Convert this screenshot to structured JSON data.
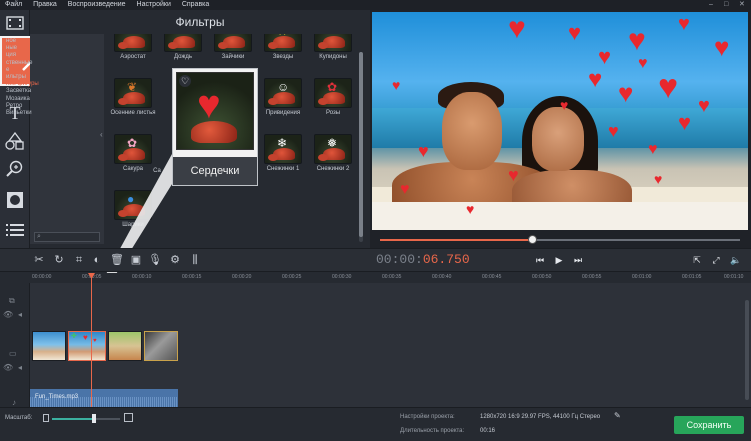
{
  "menu": {
    "items": [
      "Файл",
      "Правка",
      "Воспроизведение",
      "Настройки",
      "Справка"
    ]
  },
  "filters_panel": {
    "title": "Фильтры",
    "categories": [
      "ное",
      "ные",
      "ция",
      "ственные",
      "е",
      "ильтры",
      "ние фигуры",
      "Засветка",
      "Мозаика",
      "Ретро",
      "Виньетки"
    ],
    "active_category": "ние фигуры",
    "tiles": [
      {
        "label": "Аэростат"
      },
      {
        "label": "Дождь"
      },
      {
        "label": "Зайчики"
      },
      {
        "label": "Звезды"
      },
      {
        "label": "Купидоны"
      },
      {
        "label": "Осенние листья"
      },
      {
        "label": "Привидения"
      },
      {
        "label": "Розы"
      },
      {
        "label": "Сакура"
      },
      {
        "label": "Са"
      },
      {
        "label": "Снежинки 1"
      },
      {
        "label": "Снежинки 2"
      },
      {
        "label": "Шарики"
      }
    ],
    "hover_preview": {
      "label": "Сердечки"
    }
  },
  "player": {
    "timecode_dim": "00:00:",
    "timecode_live": "06.750",
    "progress": 0.42
  },
  "timeline": {
    "ruler": [
      "00:00:00",
      "00:00:05",
      "00:00:10",
      "00:00:15",
      "00:00:20",
      "00:00:25",
      "00:00:30",
      "00:00:35",
      "00:00:40",
      "00:00:45",
      "00:00:50",
      "00:00:55",
      "00:01:00",
      "00:01:05",
      "00:01:10",
      "00:01:15"
    ],
    "audio_clip": "Fun_Times.mp3"
  },
  "bottom": {
    "scale_label": "Масштаб:",
    "scale_level": 0.62,
    "project_settings_label": "Настройки проекта:",
    "project_settings_value": "1280x720 16:9 29.97 FPS, 44100 Гц Стерео",
    "duration_label": "Длительность проекта:",
    "duration_value": "00:16",
    "save_label": "Сохранить"
  },
  "colors": {
    "accent": "#e8674a",
    "save": "#27a55a",
    "audio": "#4a74a8"
  }
}
